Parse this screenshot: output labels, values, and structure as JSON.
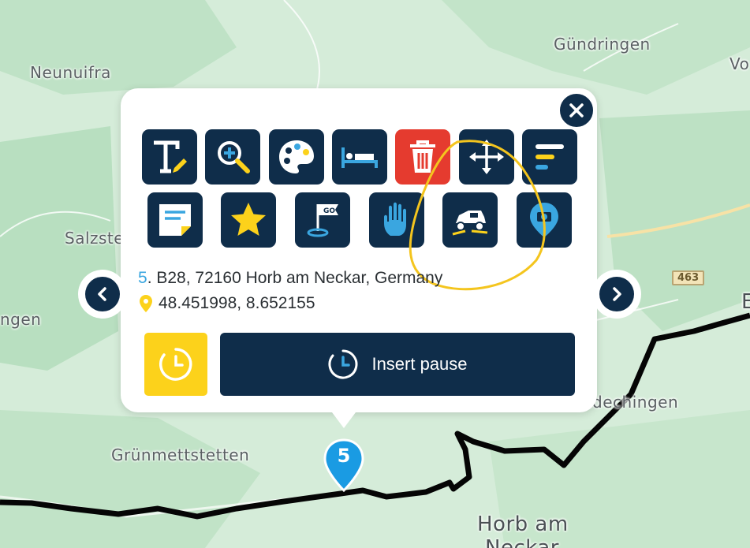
{
  "map": {
    "places": [
      "Gündringen",
      "Neunuifra",
      "Vo",
      "Salzste",
      "ngen",
      "E",
      "Grünmettstetten",
      "ldechingen",
      "Horb am",
      "Neckar"
    ],
    "road_numbers": [
      "463"
    ],
    "route_color": "#000000"
  },
  "popup": {
    "close_icon": "close-icon",
    "tools_row1": [
      "edit-text-icon",
      "zoom-in-icon",
      "palette-icon",
      "bed-icon",
      "trash-icon",
      "move-icon",
      "align-icon"
    ],
    "tools_row2": [
      "note-icon",
      "star-icon",
      "go-flag-icon",
      "hand-stop-icon",
      "offroad-car-icon",
      "map-pin-camera-icon"
    ],
    "address_number": "5",
    "address_text": ". B28, 72160 Horb am Neckar, Germany",
    "coordinates": "48.451998, 8.652155",
    "insert_pause_label": "Insert pause",
    "accent_yellow": "#fcd21b",
    "navy": "#0f2d4a",
    "danger_red": "#e53b2f"
  },
  "marker": {
    "label": "5",
    "color": "#1a9be3"
  }
}
